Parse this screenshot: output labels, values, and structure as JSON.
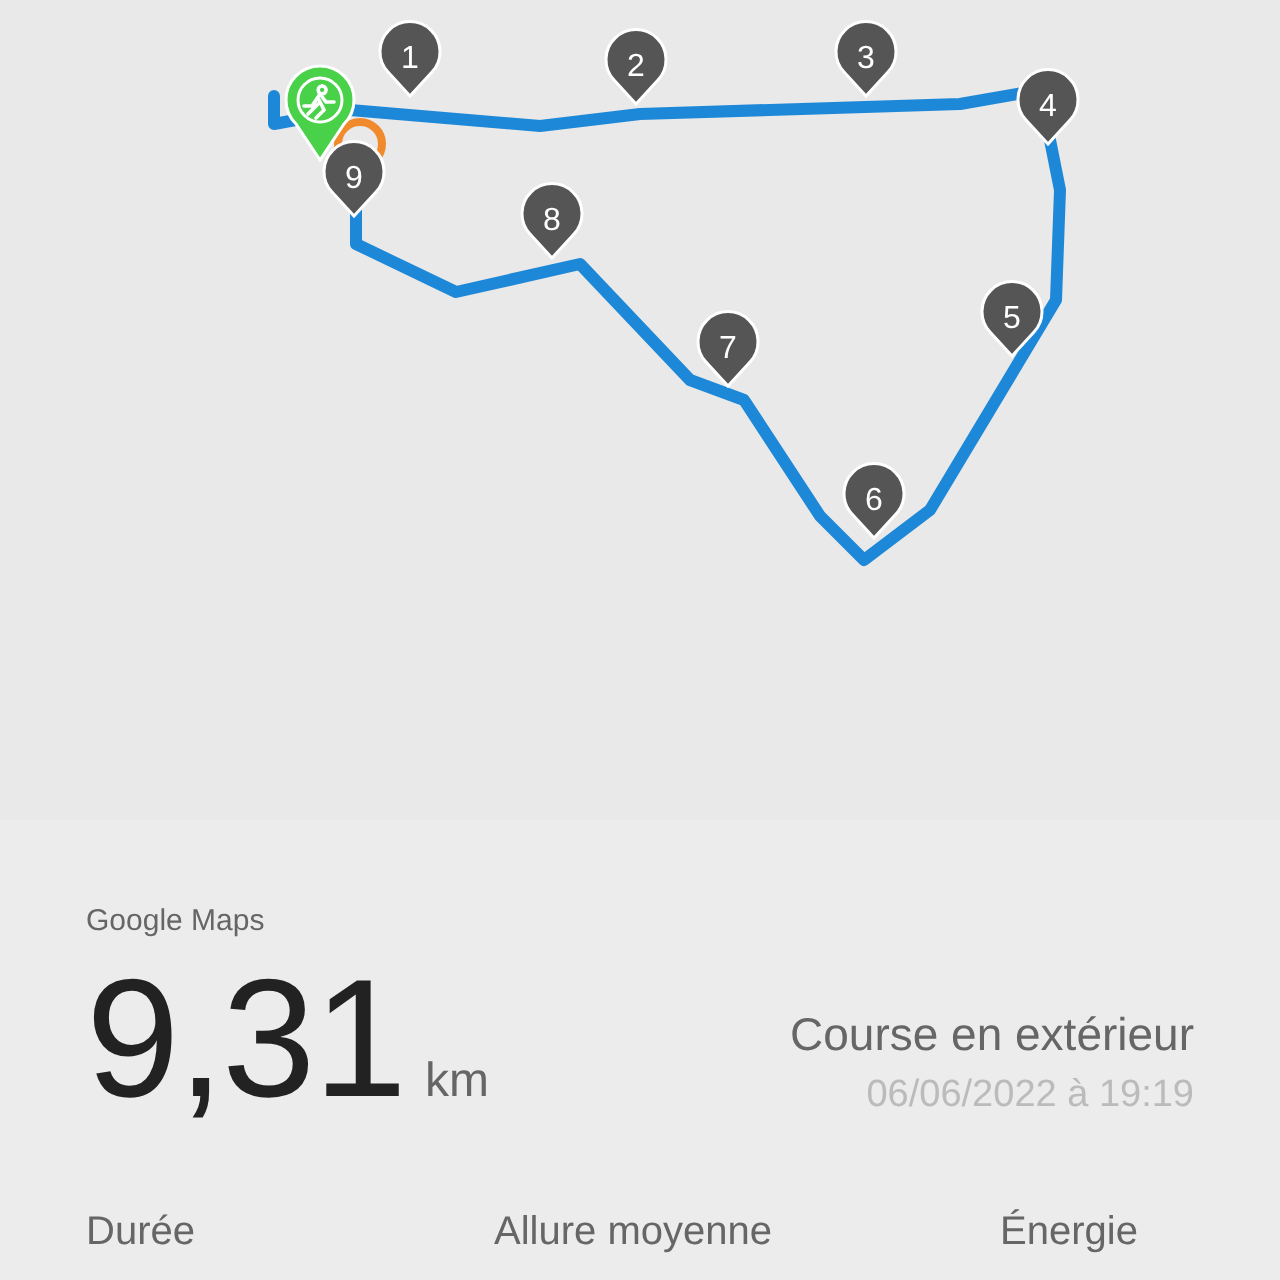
{
  "map": {
    "pins": [
      "1",
      "2",
      "3",
      "4",
      "5",
      "6",
      "7",
      "8",
      "9"
    ]
  },
  "source": "Google Maps",
  "distance": {
    "value": "9,31",
    "unit": "km"
  },
  "activity": {
    "type": "Course en extérieur",
    "datetime": "06/06/2022 à 19:19"
  },
  "stats": [
    "Durée",
    "Allure moyenne",
    "Énergie"
  ]
}
